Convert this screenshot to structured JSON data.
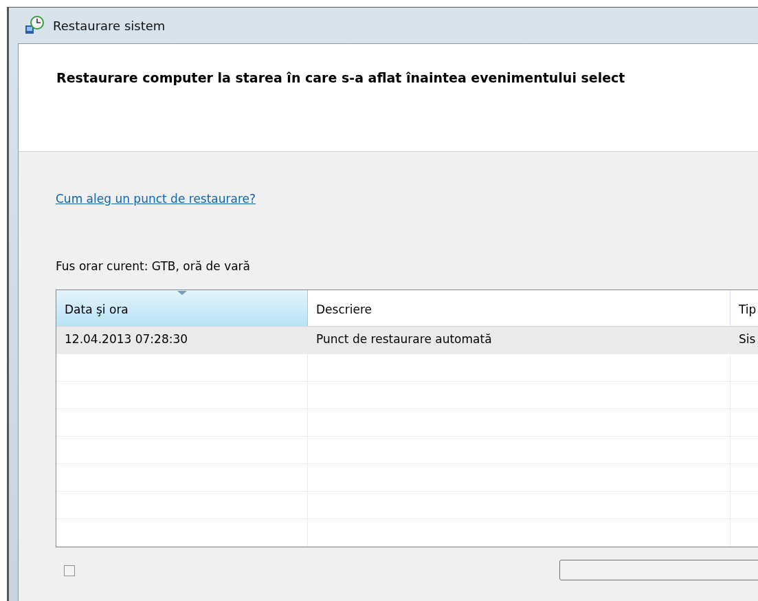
{
  "window": {
    "title": "Restaurare sistem"
  },
  "heading": "Restaurare computer la starea în care s-a aflat înaintea evenimentului select",
  "help_link": "Cum aleg un punct de restaurare?",
  "timezone": "Fus orar curent: GTB, oră de vară",
  "table": {
    "columns": [
      {
        "label": "Data şi ora",
        "sorted": true
      },
      {
        "label": "Descriere",
        "sorted": false
      },
      {
        "label": "Tip",
        "sorted": false
      }
    ],
    "rows": [
      {
        "cells": [
          "12.04.2013 07:28:30",
          "Punct de restaurare automată",
          "Sis"
        ],
        "selected": true
      }
    ]
  },
  "more_points": {
    "checked": false
  }
}
